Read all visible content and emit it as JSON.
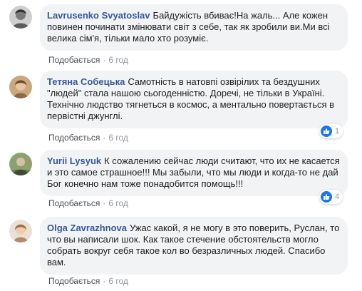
{
  "comments": [
    {
      "author": "Lavrusenko Svyatoslav",
      "text": "Байдужість вбиває!На жаль... Але кожен повинен починати змінювати світ з себе, так як зробили ви.Ми всі велика сім'я, тільки мало хто розуміє.",
      "like_label": "Подобається",
      "time": "6 год",
      "reactions": null
    },
    {
      "author": "Тетяна Собецька",
      "text": "Самотність в натовпі озвірілих та бездушних \"людей\" стала нашою сьогоденністю. Доречі, не тільки в Україні. Технічно людство тягнеться в космос, а ментально повертається в первістні джунглі.",
      "like_label": "Подобається",
      "time": "6 год",
      "reactions": "1"
    },
    {
      "author": "Yurii Lysyuk",
      "text": "К сожалению сейчас люди считают, что их не касается и это самое страшное!!! Мы забыли, что мы люди и когда-то не дай Бог конечно нам тоже понадобится помощь!!!",
      "like_label": "Подобається",
      "time": "6 год",
      "reactions": "4"
    },
    {
      "author": "Olga Zavrazhnova",
      "text": "Ужас какой, я не могу в это поверить, Руслан, то что вы написали шок. Как такое стечение обстоятельств могло собрать вокруг себя такое кол во безразличных людей. Спасибо вам.",
      "like_label": "Подобається",
      "time": "6 год",
      "reactions": null
    }
  ],
  "separator": "·",
  "colors": {
    "author": "#385898",
    "bubble": "#f2f3f5",
    "meta": "#90949c",
    "like_badge": "#1877f2"
  }
}
